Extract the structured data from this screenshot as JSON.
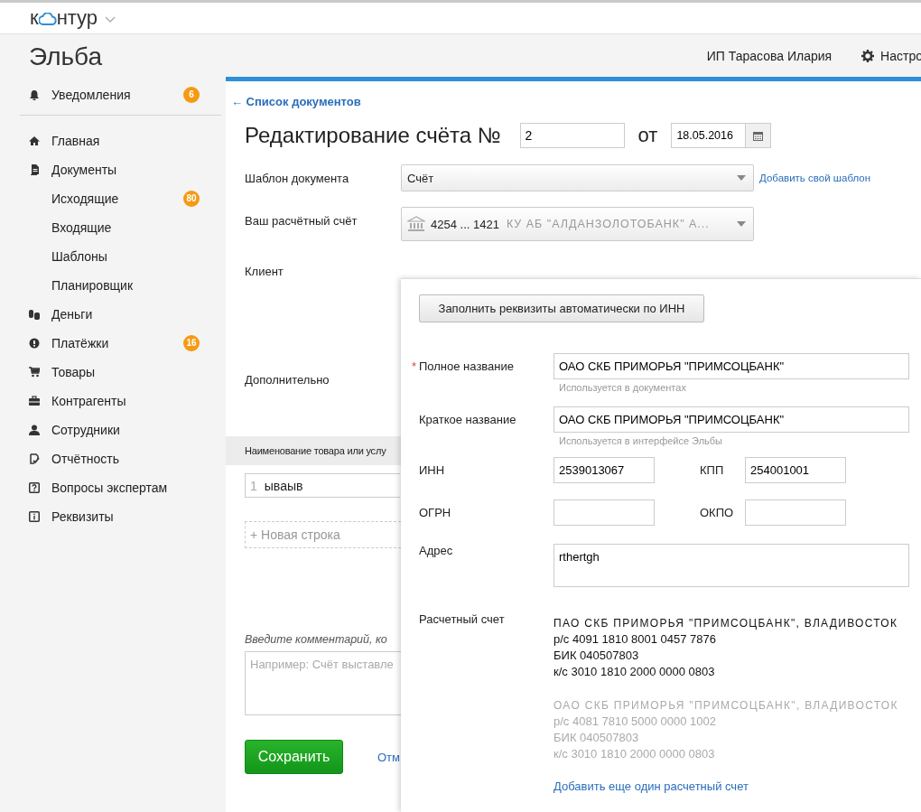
{
  "top_bar": {
    "logo_left": "к",
    "logo_right": "нтур"
  },
  "header": {
    "app_title": "Эльба",
    "user": "ИП Тарасова Илария",
    "settings": "Настро"
  },
  "sidebar": {
    "notifications": {
      "label": "Уведомления",
      "badge": "6"
    },
    "items": [
      {
        "kind": "home",
        "label": "Главная"
      },
      {
        "kind": "documents",
        "label": "Документы",
        "children": [
          {
            "label": "Исходящие",
            "badge": "80"
          },
          {
            "label": "Входящие"
          },
          {
            "label": "Шаблоны"
          },
          {
            "label": "Планировщик"
          }
        ]
      },
      {
        "kind": "money",
        "label": "Деньги"
      },
      {
        "kind": "payments",
        "label": "Платёжки",
        "badge": "16"
      },
      {
        "kind": "goods",
        "label": "Товары"
      },
      {
        "kind": "contractors",
        "label": "Контрагенты"
      },
      {
        "kind": "staff",
        "label": "Сотрудники"
      },
      {
        "kind": "reports",
        "label": "Отчётность"
      },
      {
        "kind": "questions",
        "label": "Вопросы экспертам"
      },
      {
        "kind": "details",
        "label": "Реквизиты"
      }
    ]
  },
  "main": {
    "back_link": "← Список документов",
    "heading": "Редактирование счёта №",
    "number": "2",
    "date_label": "от",
    "date": "18.05.2016",
    "template": {
      "label": "Шаблон документа",
      "value": "Счёт",
      "link": "Добавить свой шаблон"
    },
    "account": {
      "label": "Ваш расчётный счёт",
      "number": "4254 ... 1421",
      "bank": "КУ АБ \"АЛДАНЗОЛОТОБАНК\" А..."
    },
    "client_label": "Клиент",
    "extra_label": "Дополнительно",
    "table": {
      "column_1": "Наименование товара или услу",
      "rows": [
        {
          "index": "1",
          "name": "ываыв"
        }
      ],
      "new_row": "+ Новая строка"
    },
    "comment": {
      "label": "Введите комментарий, ко",
      "placeholder": "Например: Счёт выставле"
    },
    "save": "Сохранить",
    "cancel": "Отм"
  },
  "client_popup": {
    "autofill": "Заполнить реквизиты автоматически по ИНН",
    "fields": [
      {
        "kind": "wide",
        "required_mark": "*",
        "label": "Полное название",
        "value": "ОАО СКБ ПРИМОРЬЯ \"ПРИМСОЦБАНК\"",
        "hint": "Используется в документах"
      },
      {
        "kind": "wide",
        "label": "Краткое название",
        "value": "ОАО СКБ ПРИМОРЬЯ \"ПРИМСОЦБАНК\"",
        "hint": "Используется в интерфейсе Эльбы"
      },
      {
        "kind": "pair",
        "items": [
          {
            "label": "ИНН",
            "value": "2539013067"
          },
          {
            "label": "КПП",
            "value": "254001001"
          }
        ]
      },
      {
        "kind": "pair",
        "items": [
          {
            "label": "ОГРН"
          },
          {
            "label": "ОКПО"
          }
        ]
      },
      {
        "kind": "textarea",
        "label": "Адрес",
        "value": "rthertgh"
      }
    ],
    "accounts": {
      "label": "Расчетный счет",
      "items": [
        {
          "selected": true,
          "bank": "ПАО СКБ ПРИМОРЬЯ \"ПРИМСОЦБАНК\", ВЛАДИВОСТОК",
          "lines": [
            "р/с 4091 1810 8001 0457 7876",
            "БИК 040507803",
            "к/с 3010 1810 2000 0000 0803"
          ]
        },
        {
          "selected": false,
          "bank": "ОАО СКБ ПРИМОРЬЯ \"ПРИМСОЦБАНК\", ВЛАДИВОСТОК",
          "lines": [
            "р/с 4081 7810 5000 0000 1002",
            "БИК 040507803",
            "к/с 3010 1810 2000 0000 0803"
          ]
        }
      ],
      "add_link": "Добавить еще один расчетный счет"
    }
  }
}
